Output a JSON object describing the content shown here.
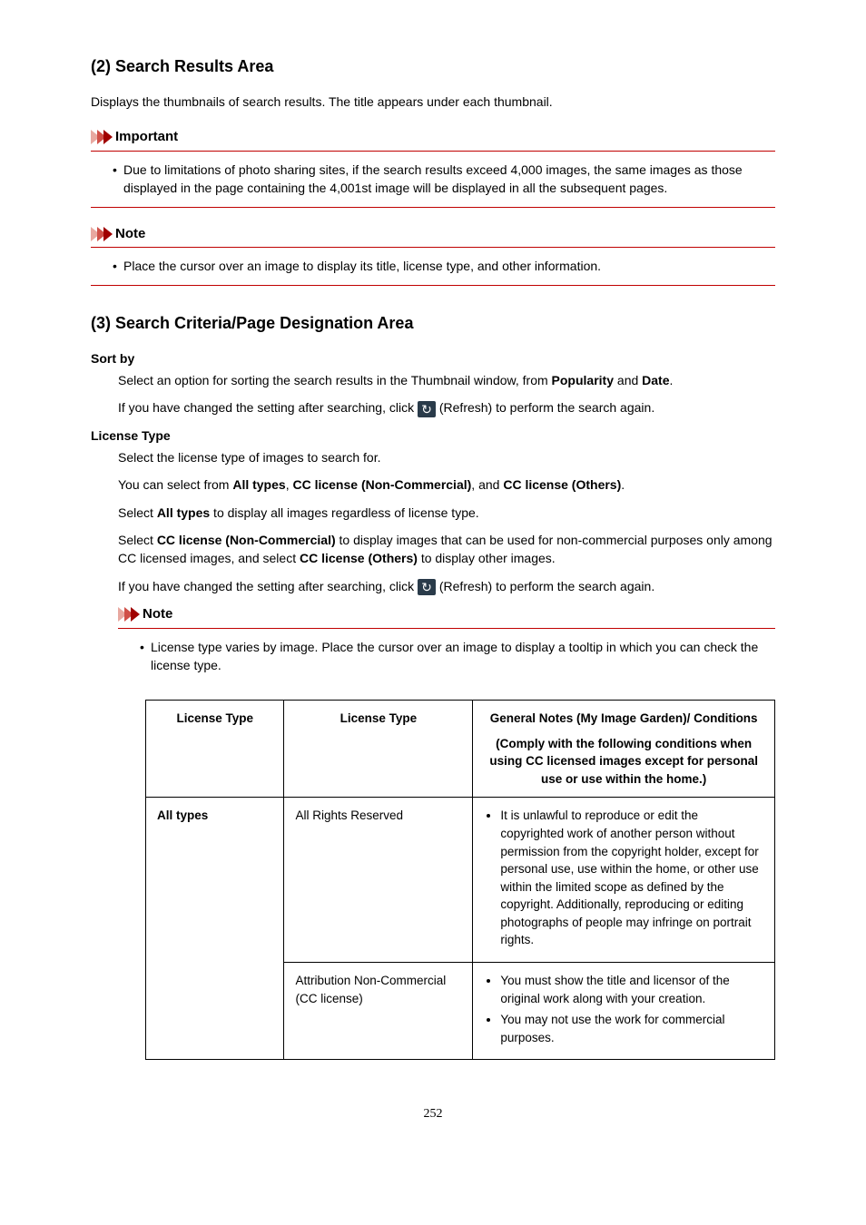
{
  "section2": {
    "heading": "(2) Search Results Area",
    "desc": "Displays the thumbnails of search results. The title appears under each thumbnail."
  },
  "importantBox": {
    "title": "Important",
    "bullet": "•",
    "text": "Due to limitations of photo sharing sites, if the search results exceed 4,000 images, the same images as those displayed in the page containing the 4,001st image will be displayed in all the subsequent pages."
  },
  "noteBox1": {
    "title": "Note",
    "bullet": "•",
    "text": "Place the cursor over an image to display its title, license type, and other information."
  },
  "section3": {
    "heading": "(3) Search Criteria/Page Designation Area"
  },
  "sortBy": {
    "label": "Sort by",
    "p1_a": "Select an option for sorting the search results in the Thumbnail window, from ",
    "p1_b": "Popularity",
    "p1_c": " and ",
    "p1_d": "Date",
    "p1_e": ".",
    "p2_a": "If you have changed the setting after searching, click ",
    "p2_b": " (Refresh) to perform the search again.",
    "refreshGlyph": "↻"
  },
  "licenseType": {
    "label": "License Type",
    "p1": "Select the license type of images to search for.",
    "p2_a": "You can select from ",
    "p2_b": "All types",
    "p2_c": ", ",
    "p2_d": "CC license (Non-Commercial)",
    "p2_e": ", and ",
    "p2_f": "CC license (Others)",
    "p2_g": ".",
    "p3_a": "Select ",
    "p3_b": "All types",
    "p3_c": " to display all images regardless of license type.",
    "p4_a": "Select ",
    "p4_b": "CC license (Non-Commercial)",
    "p4_c": " to display images that can be used for non-commercial purposes only among CC licensed images, and select ",
    "p4_d": "CC license (Others)",
    "p4_e": " to display other images.",
    "p5_a": "If you have changed the setting after searching, click ",
    "p5_b": " (Refresh) to perform the search again.",
    "refreshGlyph": "↻"
  },
  "noteBox2": {
    "title": "Note",
    "bullet": "•",
    "text": "License type varies by image. Place the cursor over an image to display a tooltip in which you can check the license type."
  },
  "table": {
    "headers": {
      "c1": "License Type",
      "c2": "License Type",
      "c3_line1": "General Notes (My Image Garden)/ Conditions",
      "c3_line2": "(Comply with the following conditions when using CC licensed images except for personal use or use within the home.)"
    },
    "rows": [
      {
        "c1": "All types",
        "c2": "All Rights Reserved",
        "c3": [
          "It is unlawful to reproduce or edit the copyrighted work of another person without permission from the copyright holder, except for personal use, use within the home, or other use within the limited scope as defined by the copyright. Additionally, reproducing or editing photographs of people may infringe on portrait rights."
        ]
      },
      {
        "c1": "",
        "c2": "Attribution Non-Commercial (CC license)",
        "c3": [
          "You must show the title and licensor of the original work along with your creation.",
          "You may not use the work for commercial purposes."
        ]
      }
    ]
  },
  "pageNumber": "252"
}
